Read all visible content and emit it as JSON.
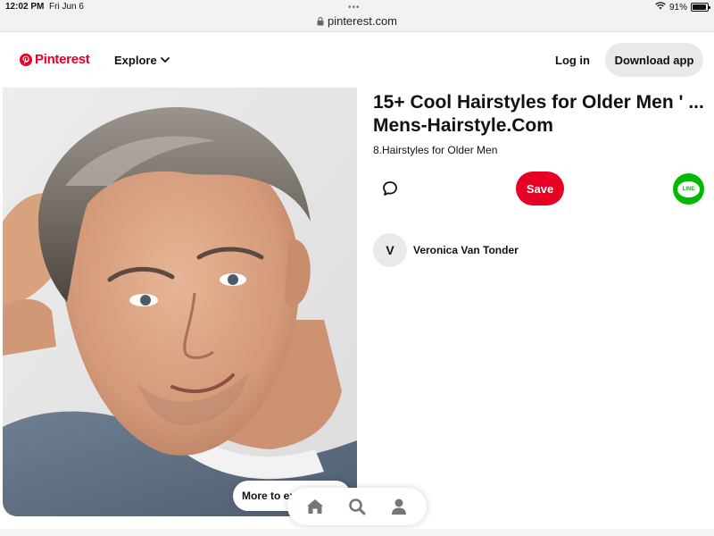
{
  "status_bar": {
    "time": "12:02 PM",
    "date": "Fri Jun 6",
    "url": "pinterest.com",
    "battery": "91%",
    "battery_level": 0.91
  },
  "header": {
    "logo_text": "Pinterest",
    "explore_label": "Explore",
    "login_label": "Log in",
    "download_label": "Download app"
  },
  "pin": {
    "title": "15+ Cool Hairstyles for Older Men ' ... Mens-Hairstyle.Com",
    "description": "8.Hairstyles for Older Men",
    "save_label": "Save",
    "share_line_label": "LINE"
  },
  "author": {
    "initial": "V",
    "name": "Veronica Van Tonder"
  },
  "bottom": {
    "more_label": "More to explore"
  },
  "colors": {
    "brand": "#e60023",
    "line_green": "#00b900"
  },
  "icons": {
    "comment": "comment-icon",
    "home": "home-icon",
    "search": "search-icon",
    "profile": "person-icon"
  }
}
